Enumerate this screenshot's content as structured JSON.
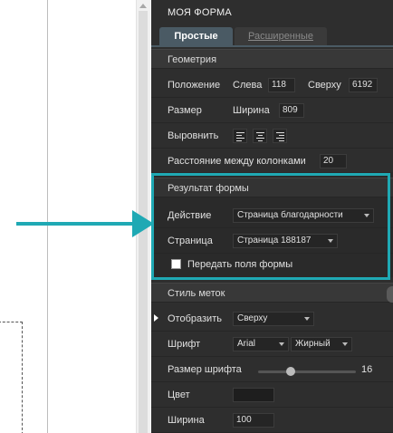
{
  "colors": {
    "accent": "#1fa9b4",
    "panel_bg": "#2e2e2e",
    "tab_active": "#4a5a64"
  },
  "panel": {
    "title": "МОЯ ФОРМА",
    "tabs": [
      {
        "label": "Простые",
        "active": true
      },
      {
        "label": "Расширенные",
        "active": false
      }
    ]
  },
  "geometry": {
    "section_title": "Геометрия",
    "position_label": "Положение",
    "left_label": "Слева",
    "left_value": "118",
    "top_label": "Сверху",
    "top_value": "6192",
    "size_label": "Размер",
    "width_label": "Ширина",
    "width_value": "809",
    "align_label": "Выровнить",
    "align_icons": [
      "align-left-icon",
      "align-center-icon",
      "align-right-icon"
    ],
    "column_gap_label": "Расстояние между колонками",
    "column_gap_value": "20"
  },
  "form_result": {
    "section_title": "Результат формы",
    "action_label": "Действие",
    "action_value": "Страница благодарности",
    "page_label": "Страница",
    "page_value": "Страница 188187",
    "pass_fields_label": "Передать поля формы",
    "pass_fields_checked": false
  },
  "label_style": {
    "section_title": "Стиль меток",
    "display_label": "Отобразить",
    "display_value": "Сверху",
    "font_label": "Шрифт",
    "font_value": "Arial",
    "weight_value": "Жирный",
    "font_size_label": "Размер шрифта",
    "font_size_value": "16",
    "font_size_level": 0.33,
    "color_label": "Цвет",
    "color_value": "#1e1e1e",
    "width_label": "Ширина",
    "width_value": "100"
  }
}
